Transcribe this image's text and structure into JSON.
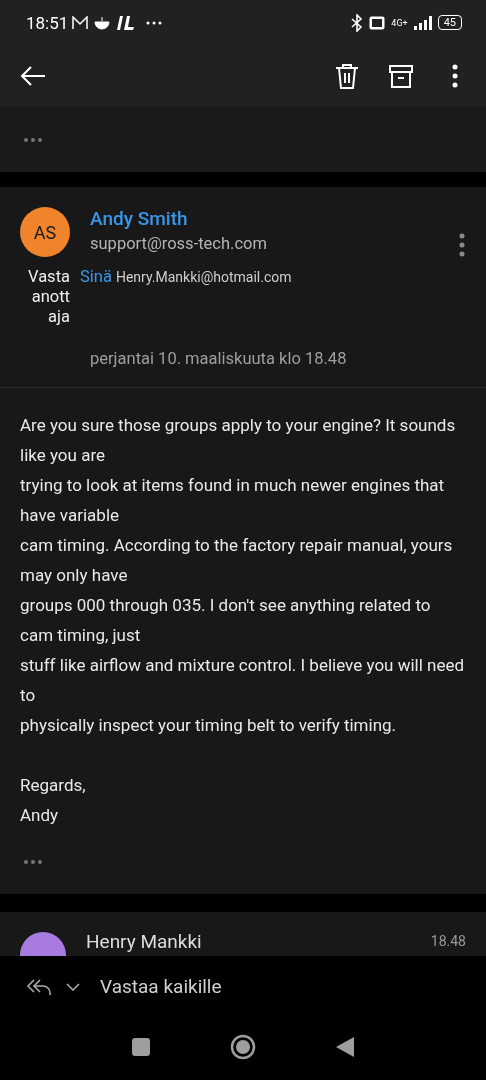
{
  "status_bar": {
    "time": "18:51",
    "battery": "45",
    "network": "4G+"
  },
  "message": {
    "avatar_initials": "AS",
    "color": "#f0842c",
    "sender_name": "Andy Smith",
    "sender_email": "support@ross-tech.com",
    "recipient_label": "Vasta anott aja",
    "recipient_name": "Sinä",
    "recipient_email": "Henry.Mankki@hotmail.com",
    "date": "perjantai 10. maaliskuuta klo 18.48",
    "body": [
      [
        "Are you sure those groups apply to your engine? It sounds like you are",
        "trying to look at items found in much newer engines that have variable",
        "cam timing. According to the factory repair manual, yours may only have",
        "groups 000 through 035. I don't see anything related to cam timing, just",
        "stuff like airflow and mixture control. I believe you will need to",
        "physically inspect your timing belt to verify timing."
      ],
      [
        "Regards,",
        "Andy"
      ]
    ]
  },
  "next_message": {
    "color": "#a77be0",
    "sender_name": "Henry Mankki",
    "time": "18.48"
  },
  "reply_bar": {
    "label": "Vastaa kaikille"
  }
}
